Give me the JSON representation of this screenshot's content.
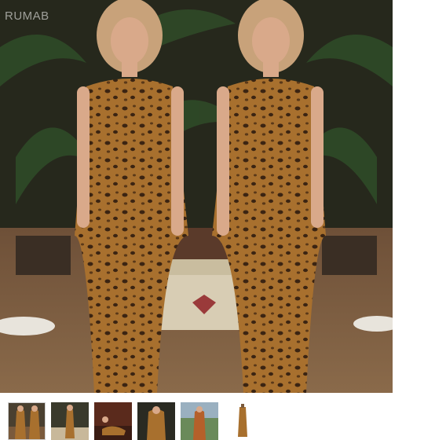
{
  "gallery": {
    "watermark": "RUMAB",
    "main_image": {
      "icon": "leopard-print-dress-photo",
      "colors": {
        "floor": "#7a5a3c",
        "palms": "#2e4a2a",
        "dress": "#a46a2c",
        "spots": "#3b2412"
      }
    },
    "thumbnails": [
      {
        "icon": "thumb-photo-1",
        "selected": true
      },
      {
        "icon": "thumb-photo-2",
        "selected": false
      },
      {
        "icon": "thumb-photo-3",
        "selected": false
      },
      {
        "icon": "thumb-photo-4",
        "selected": false
      },
      {
        "icon": "thumb-photo-5",
        "selected": false
      },
      {
        "icon": "thumb-photo-6",
        "selected": false
      }
    ]
  }
}
